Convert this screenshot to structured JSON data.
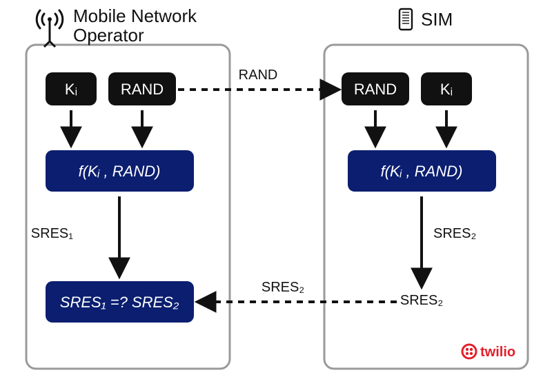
{
  "left": {
    "title_line1": "Mobile Network",
    "title_line2": "Operator",
    "inputs": {
      "ki": "Kᵢ",
      "rand": "RAND"
    },
    "function": "f(Kᵢ , RAND)",
    "sres1_label": "SRES₁",
    "compare": "SRES₁ =? SRES₂"
  },
  "right": {
    "title": "SIM",
    "inputs": {
      "ki": "Kᵢ",
      "rand": "RAND"
    },
    "function": "f(Kᵢ , RAND)",
    "sres2_label": "SRES₂",
    "sres2_output": "SRES₂"
  },
  "messages": {
    "rand": "RAND",
    "sres2": "SRES₂"
  },
  "brand": "twilio"
}
